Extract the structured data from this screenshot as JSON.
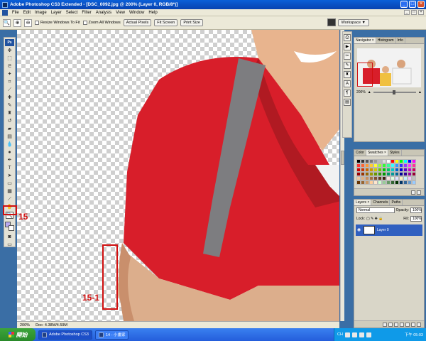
{
  "window": {
    "title": "Adobe Photoshop CS3 Extended - [DSC_0092.jpg @ 200% (Layer 0, RGB/8*)]",
    "controls": [
      "_",
      "□",
      "×"
    ]
  },
  "menu": {
    "items": [
      "File",
      "Edit",
      "Image",
      "Layer",
      "Select",
      "Filter",
      "Analysis",
      "View",
      "Window",
      "Help"
    ],
    "mdi_controls": [
      "_",
      "□",
      "×"
    ]
  },
  "options": {
    "resize_windows": "Resize Windows To Fit",
    "zoom_all": "Zoom All Windows",
    "actual_pixels": "Actual Pixels",
    "fit_screen": "Fit Screen",
    "print_size": "Print Size",
    "workspace": "Workspace ▼"
  },
  "toolbox": {
    "badge": "Ps"
  },
  "annotations": {
    "label_15": "15",
    "label_15_1": "15-1"
  },
  "status": {
    "zoom": "200%",
    "doc": "Doc: 4.38M/4.59M"
  },
  "panels": {
    "navigator_tabs": [
      "Navigator ×",
      "Histogram",
      "Info"
    ],
    "navigator_zoom": "200%",
    "color_tabs": [
      "Color",
      "Swatches ×",
      "Styles"
    ],
    "layers_tabs": [
      "Layers ×",
      "Channels",
      "Paths"
    ],
    "blend_mode": "Normal",
    "opacity_label": "Opacity:",
    "opacity_value": "100%",
    "lock_label": "Lock:",
    "fill_label": "Fill:",
    "fill_value": "100%",
    "layer_name": "Layer 0"
  },
  "swatch_colors": [
    "#000000",
    "#333333",
    "#555555",
    "#777777",
    "#999999",
    "#bbbbbb",
    "#dddddd",
    "#ffffff",
    "#ff0000",
    "#ffff00",
    "#00ff00",
    "#00ffff",
    "#0000ff",
    "#ff00ff",
    "#ff3333",
    "#ff6633",
    "#ff9933",
    "#ffcc33",
    "#ffff33",
    "#99ff33",
    "#33ff33",
    "#33ff99",
    "#33ffff",
    "#3399ff",
    "#3333ff",
    "#9933ff",
    "#ff33ff",
    "#ff3399",
    "#cc0000",
    "#cc3300",
    "#cc6600",
    "#cc9900",
    "#cccc00",
    "#66cc00",
    "#00cc00",
    "#00cc66",
    "#00cccc",
    "#0066cc",
    "#0000cc",
    "#6600cc",
    "#cc00cc",
    "#cc0066",
    "#990000",
    "#993300",
    "#996600",
    "#999900",
    "#669900",
    "#339900",
    "#009900",
    "#009966",
    "#009999",
    "#006699",
    "#000099",
    "#330099",
    "#990099",
    "#990033",
    "#f0c8a0",
    "#e0b080",
    "#c89060",
    "#a07040",
    "#805030",
    "#603820",
    "#402010",
    "#ffe0e0",
    "#e0ffe0",
    "#e0e0ff",
    "#fff0c0",
    "#c0f0ff",
    "#f0c0ff",
    "#c0c0c0",
    "#663300",
    "#996633",
    "#cc9966",
    "#ffcc99",
    "#ffe6cc",
    "#ccffcc",
    "#99cc99",
    "#669966",
    "#336633",
    "#003300",
    "#003366",
    "#336699",
    "#6699cc",
    "#99ccff"
  ],
  "taskbar": {
    "start": "開始",
    "task_photoshop": "Adobe Photoshop CS3",
    "task_other": "14 - 小畫家",
    "lang": "CH",
    "clock": "下午 05:03"
  }
}
